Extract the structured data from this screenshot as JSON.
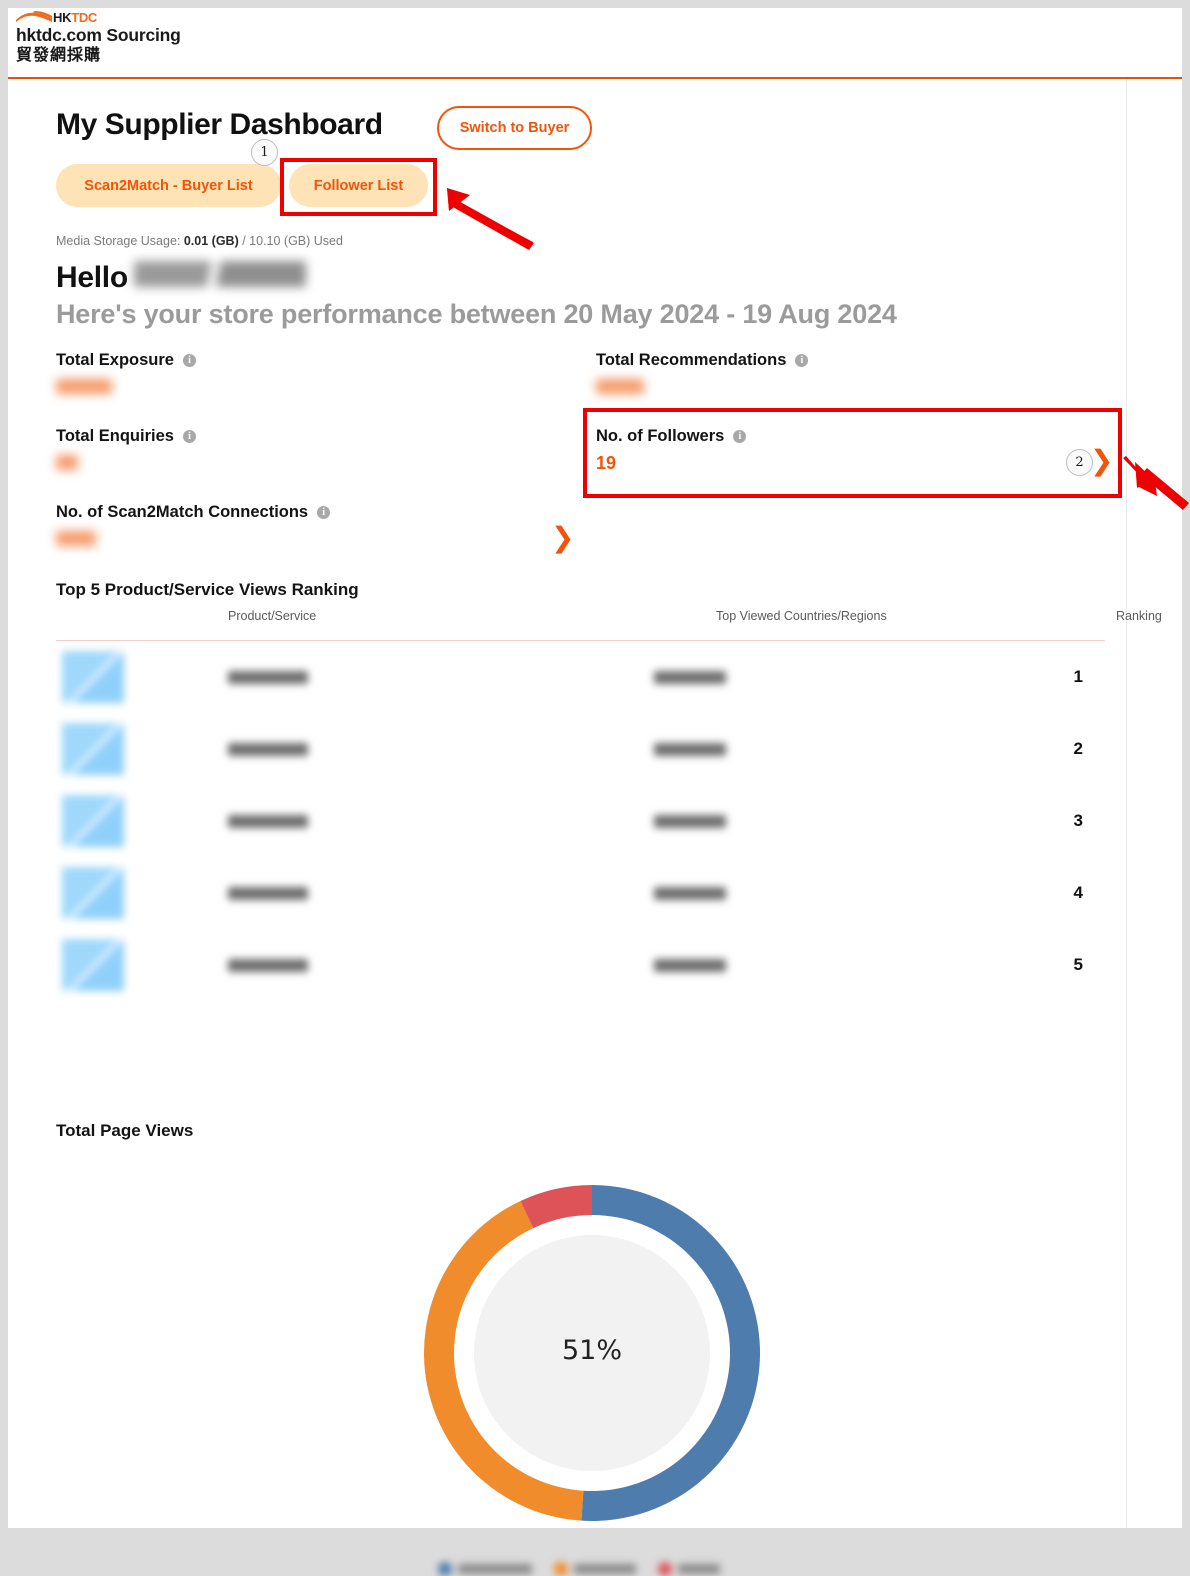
{
  "brand": {
    "logo_hk": "HK",
    "logo_tdc": "TDC",
    "name_en": "hktdc.com Sourcing",
    "name_zh": "貿發網採購",
    "accent": "#f2540a",
    "wave_color": "#ef6c1a"
  },
  "header": {
    "title": "My Supplier Dashboard",
    "switch_button": "Switch to Buyer"
  },
  "tabs": [
    {
      "label": "Scan2Match - Buyer List",
      "name": "scan2match-buyer-list"
    },
    {
      "label": "Follower List",
      "name": "follower-list"
    }
  ],
  "storage": {
    "prefix": "Media Storage Usage: ",
    "used": "0.01 (GB)",
    "suffix": " / 10.10 (GB) Used"
  },
  "greeting": {
    "hello": "Hello",
    "user_name_redacted": true,
    "performance": "Here's your store performance between 20 May 2024 - 19 Aug 2024"
  },
  "metrics": [
    {
      "name": "total-exposure",
      "label": "Total Exposure",
      "value": "",
      "redacted": true
    },
    {
      "name": "total-recommendations",
      "label": "Total Recommendations",
      "value": "",
      "redacted": true
    },
    {
      "name": "total-enquiries",
      "label": "Total Enquiries",
      "value": "",
      "redacted": true
    },
    {
      "name": "no-of-followers",
      "label": "No. of Followers",
      "value": "19",
      "redacted": false
    },
    {
      "name": "no-of-scan2match-connections",
      "label": "No. of Scan2Match Connections",
      "value": "",
      "redacted": true
    }
  ],
  "metric_labels": {
    "total_exposure": "Total Exposure",
    "total_recommendations": "Total Recommendations",
    "total_enquiries": "Total Enquiries",
    "no_of_followers": "No. of Followers",
    "followers_value": "19",
    "no_of_scan2match": "No. of Scan2Match Connections"
  },
  "ranking": {
    "title": "Top 5 Product/Service Views Ranking",
    "columns": {
      "product": "Product/Service",
      "countries": "Top Viewed Countries/Regions",
      "ranking": "Ranking"
    },
    "rows": [
      {
        "product": "",
        "country": "",
        "rank": "1",
        "redacted": true
      },
      {
        "product": "",
        "country": "",
        "rank": "2",
        "redacted": true
      },
      {
        "product": "",
        "country": "",
        "rank": "3",
        "redacted": true
      },
      {
        "product": "",
        "country": "",
        "rank": "4",
        "redacted": true
      },
      {
        "product": "",
        "country": "",
        "rank": "5",
        "redacted": true
      }
    ],
    "rank_labels": [
      "1",
      "2",
      "3",
      "4",
      "5"
    ]
  },
  "page_views": {
    "title": "Total Page Views",
    "center_label": "51%"
  },
  "chart_data": {
    "type": "pie",
    "title": "Total Page Views",
    "variant": "donut",
    "center_label": "51%",
    "legend_position": "bottom",
    "legend_redacted": true,
    "categories": [
      "Series 1",
      "Series 2",
      "Series 3"
    ],
    "values": [
      51,
      42,
      7
    ],
    "unit": "%",
    "colors": [
      "#4e7cac",
      "#f08c2b",
      "#de5358"
    ],
    "start_angle_deg": 0,
    "direction": "clockwise"
  },
  "annotations": {
    "markers": [
      {
        "id": "1",
        "target": "follower-list-tab"
      },
      {
        "id": "2",
        "target": "no-of-followers-metric"
      }
    ],
    "highlight_color": "#ee0000",
    "arrow_color": "#ee0000"
  },
  "icons": {
    "info": "i",
    "chevron_right": "❯"
  }
}
